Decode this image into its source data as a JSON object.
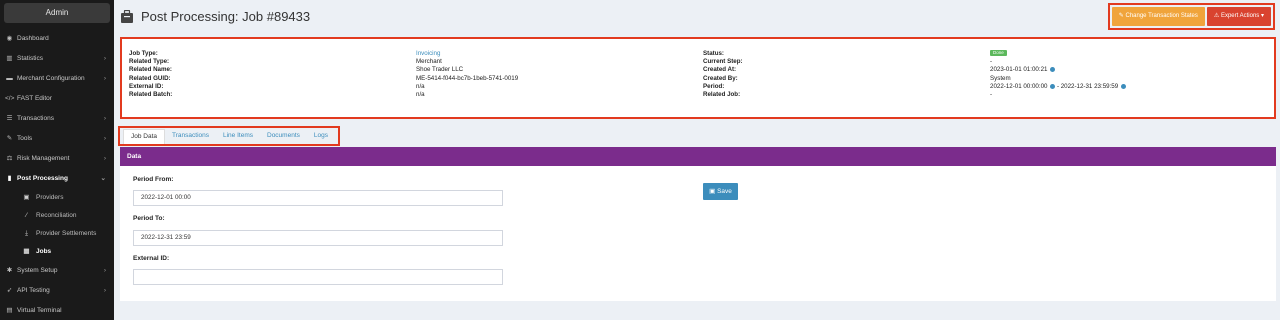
{
  "sidebar": {
    "admin_label": "Admin",
    "items": [
      {
        "label": "Dashboard",
        "icon": "dashboard-icon",
        "chevron": false
      },
      {
        "label": "Statistics",
        "icon": "bar-chart-icon",
        "chevron": true
      },
      {
        "label": "Merchant Configuration",
        "icon": "card-icon",
        "chevron": true
      },
      {
        "label": "FAST Editor",
        "icon": "code-icon",
        "chevron": false
      },
      {
        "label": "Transactions",
        "icon": "list-icon",
        "chevron": true
      },
      {
        "label": "Tools",
        "icon": "wrench-icon",
        "chevron": true
      },
      {
        "label": "Risk Management",
        "icon": "scale-icon",
        "chevron": true
      },
      {
        "label": "Post Processing",
        "icon": "file-icon",
        "chevron": true
      },
      {
        "label": "System Setup",
        "icon": "gear-icon",
        "chevron": true
      },
      {
        "label": "API Testing",
        "icon": "rocket-icon",
        "chevron": true
      },
      {
        "label": "Virtual Terminal",
        "icon": "calculator-icon",
        "chevron": false
      }
    ],
    "post_processing_sub": [
      {
        "label": "Providers",
        "icon": "provider-icon"
      },
      {
        "label": "Reconciliation",
        "icon": "magic-icon"
      },
      {
        "label": "Provider Settlements",
        "icon": "download-icon"
      },
      {
        "label": "Jobs",
        "icon": "briefcase-icon"
      }
    ]
  },
  "header": {
    "title": "Post Processing: Job #89433",
    "change_states_label": "Change Transaction States",
    "expert_actions_label": "Expert Actions"
  },
  "info": {
    "left_labels": [
      "Job Type:",
      "Related Type:",
      "Related Name:",
      "Related GUID:",
      "External ID:",
      "Related Batch:"
    ],
    "left_values": [
      "Invoicing",
      "Merchant",
      "Shoe Trader LLC",
      "ME-5414-f044-bc7b-1beb-5741-0019",
      "n/a",
      "n/a"
    ],
    "right_labels": [
      "Status:",
      "Current Step:",
      "Created At:",
      "Created By:",
      "Period:",
      "Related Job:"
    ],
    "status_badge": "Done",
    "current_step": "-",
    "created_at": "2023-01-01 01:00:21",
    "created_by": "System",
    "period_from": "2022-12-01 00:00:00",
    "period_sep": "- ",
    "period_to": "2022-12-31 23:59:59",
    "related_job": "-"
  },
  "tabs": [
    "Job Data",
    "Transactions",
    "Line Items",
    "Documents",
    "Logs"
  ],
  "content": {
    "section_title": "Data",
    "period_from_label": "Period From:",
    "period_from_value": "2022-12-01 00:00",
    "period_to_label": "Period To:",
    "period_to_value": "2022-12-31 23:59",
    "external_id_label": "External ID:",
    "external_id_value": "",
    "save_label": "Save"
  },
  "colors": {
    "accent": "#3c8dbc",
    "section_bar": "#7b2c8c",
    "warning_button": "#f0a43b",
    "danger_button": "#d9432f",
    "status_done": "#5cb85c",
    "highlight_border": "#e23a1f"
  }
}
